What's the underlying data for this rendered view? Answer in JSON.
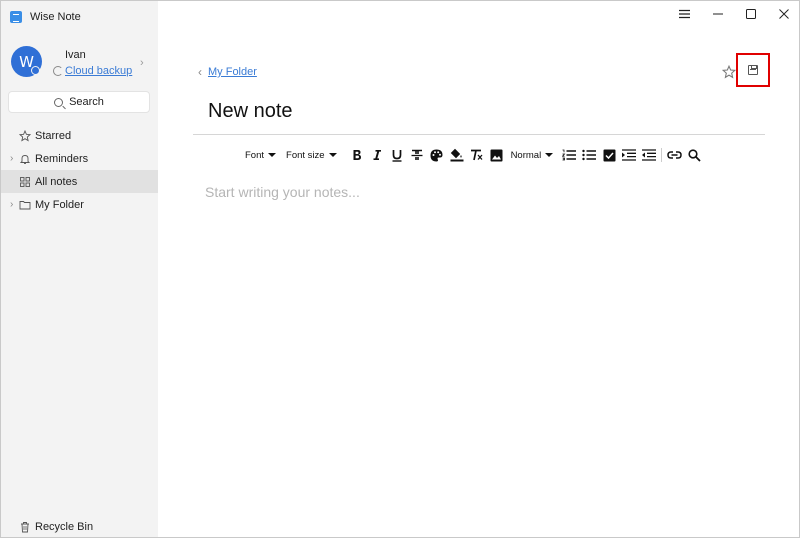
{
  "app": {
    "title": "Wise Note"
  },
  "window_controls": {
    "menu": "≡",
    "minimize": "–",
    "maximize": "☐",
    "close": "✕"
  },
  "profile": {
    "avatar_letter": "W",
    "name": "Ivan",
    "sync_label": "Cloud backup"
  },
  "search": {
    "label": "Search"
  },
  "sidebar": {
    "items": [
      {
        "label": "Starred",
        "icon": "star-icon",
        "has_chevron": false
      },
      {
        "label": "Reminders",
        "icon": "bell-icon",
        "has_chevron": true
      },
      {
        "label": "All notes",
        "icon": "grid-icon",
        "has_chevron": false,
        "active": true
      },
      {
        "label": "My Folder",
        "icon": "folder-icon",
        "has_chevron": true
      }
    ],
    "recycle_bin": "Recycle Bin"
  },
  "note": {
    "breadcrumb": "My Folder",
    "title": "New note",
    "placeholder": "Start writing your notes..."
  },
  "toolbar": {
    "font_label": "Font",
    "font_size_label": "Font size",
    "paragraph_label": "Normal"
  },
  "colors": {
    "accent": "#3a7bd5",
    "highlight_box": "#e00000",
    "sidebar_bg": "#f3f3f3",
    "active_item_bg": "#e1e1e1"
  }
}
